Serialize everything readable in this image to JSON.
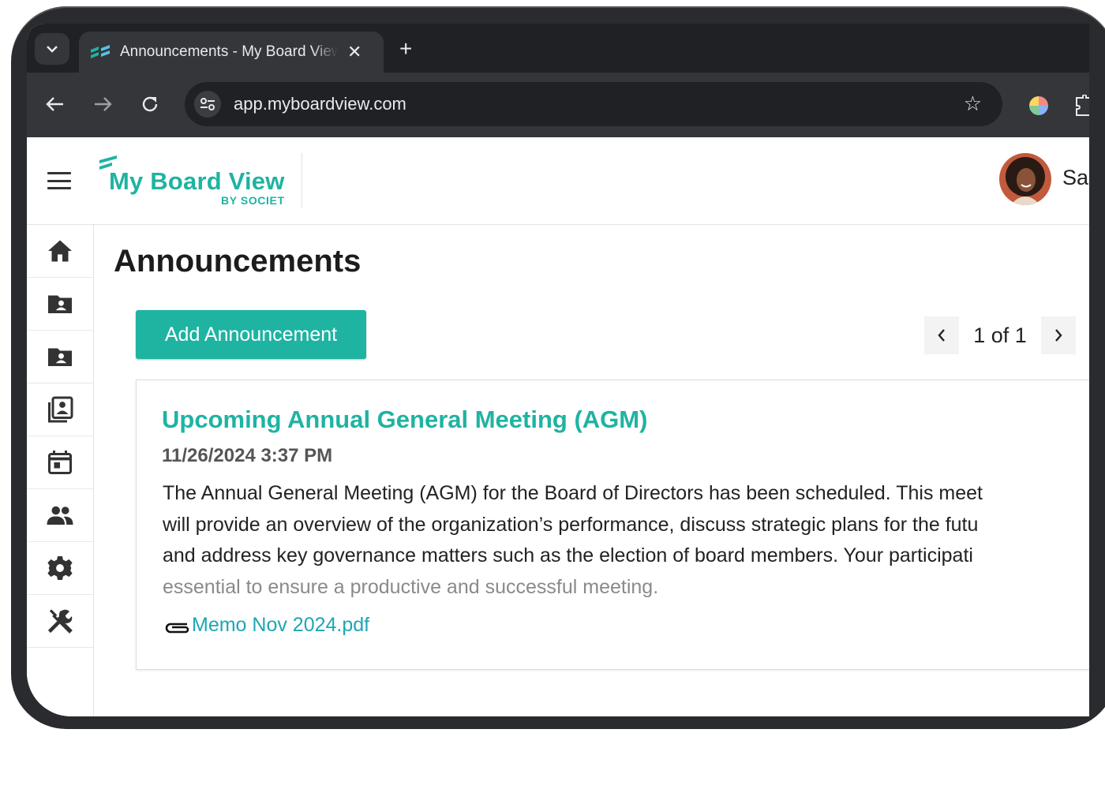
{
  "browser": {
    "tab_title": "Announcements - My Board View",
    "url": "app.myboardview.com"
  },
  "app": {
    "logo_name": "My Board View",
    "logo_by": "BY SOCIET",
    "user_name": "Sa"
  },
  "sidebar": {
    "items": [
      {
        "icon": "home-icon"
      },
      {
        "icon": "folder-account-icon"
      },
      {
        "icon": "folder-account-icon"
      },
      {
        "icon": "book-account-icon"
      },
      {
        "icon": "calendar-icon"
      },
      {
        "icon": "people-icon"
      },
      {
        "icon": "gear-icon"
      },
      {
        "icon": "tools-icon"
      }
    ]
  },
  "main": {
    "page_title": "Announcements",
    "add_button_label": "Add Announcement",
    "pager_text": "1 of 1"
  },
  "announcement": {
    "title": "Upcoming Annual General Meeting (AGM)",
    "date": "11/26/2024 3:37 PM",
    "lines": [
      "The Annual General Meeting (AGM) for the Board of Directors has been scheduled. This meet",
      "will provide an overview of the organization’s performance, discuss strategic plans for the futu",
      "and address key governance matters such as the election of board members. Your participati",
      "essential to ensure a productive and successful meeting."
    ],
    "attachment": "Memo Nov 2024.pdf"
  },
  "colors": {
    "brand": "#1fb3a2",
    "link": "#1ea6b4",
    "chrome_dark": "#202124",
    "chrome_toolbar": "#35363a"
  }
}
